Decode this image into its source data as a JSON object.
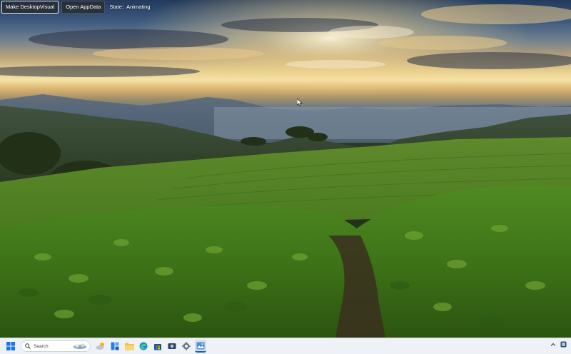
{
  "controls": {
    "make_button_label": "Make DesktopVisual",
    "open_button_label": "Open AppData",
    "state_label": "State:",
    "state_value": "Animating"
  },
  "taskbar": {
    "search_label": "Search",
    "items": [
      {
        "icon": "start-windows-icon"
      },
      {
        "icon": "search-icon"
      },
      {
        "icon": "weather-icon"
      },
      {
        "icon": "widgets-icon"
      },
      {
        "icon": "file-explorer-icon"
      },
      {
        "icon": "edge-browser-icon"
      },
      {
        "icon": "store-icon"
      },
      {
        "icon": "camera-icon"
      },
      {
        "icon": "settings-gear-icon"
      },
      {
        "icon": "photos-app-icon"
      }
    ],
    "tray": [
      {
        "icon": "chevron-up-icon"
      },
      {
        "icon": "app-indicator-icon"
      }
    ]
  },
  "colors": {
    "button_bg": "#282d34",
    "taskbar_bg": "#eef2f6",
    "accent_blue": "#0a64c8"
  }
}
